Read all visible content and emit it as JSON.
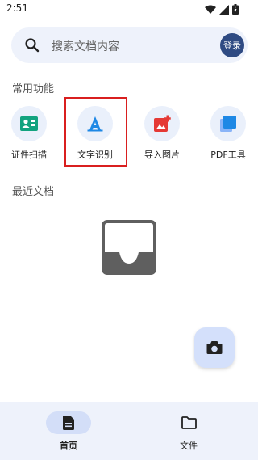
{
  "status": {
    "time": "2:51"
  },
  "search": {
    "placeholder": "搜索文档内容",
    "login_label": "登录"
  },
  "sections": {
    "common": "常用功能",
    "recent": "最近文档"
  },
  "functions": [
    {
      "label": "证件扫描",
      "icon": "id-card-icon"
    },
    {
      "label": "文字识别",
      "icon": "text-recognition-icon"
    },
    {
      "label": "导入图片",
      "icon": "image-import-icon"
    },
    {
      "label": "PDF工具",
      "icon": "pdf-tool-icon"
    }
  ],
  "fab": {
    "icon": "camera-icon"
  },
  "nav": [
    {
      "label": "首页",
      "icon": "document-icon",
      "active": true
    },
    {
      "label": "文件",
      "icon": "folder-icon",
      "active": false
    }
  ],
  "colors": {
    "accent": "#1e88e5",
    "login_bg": "#2f4b83",
    "idcard": "#12a37f",
    "image": "#e53935",
    "highlight": "#d91f1f"
  }
}
